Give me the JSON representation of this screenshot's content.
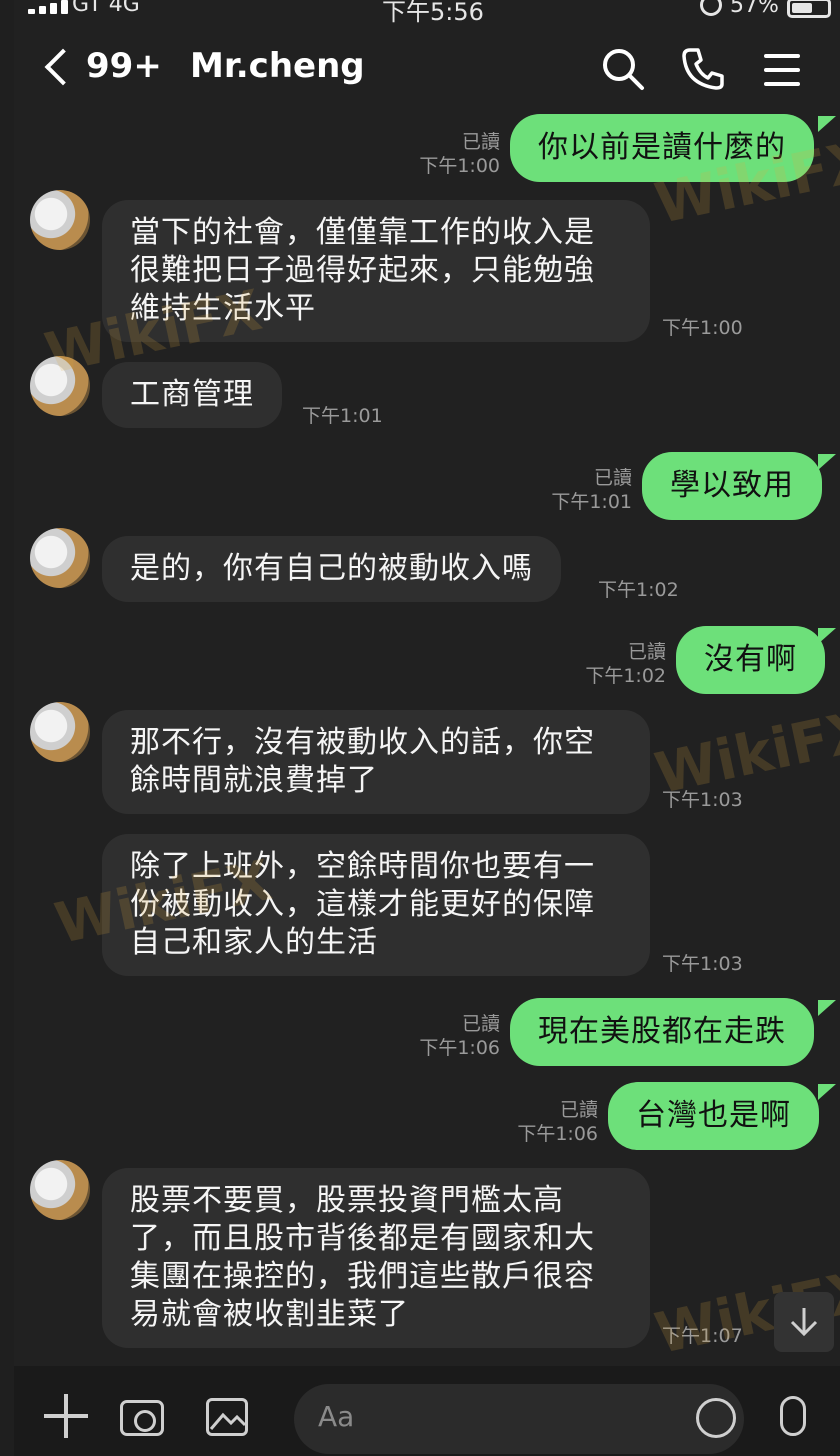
{
  "status_bar": {
    "carrier": "GT  4G",
    "time": "下午5:56",
    "battery": "57%"
  },
  "header": {
    "unread_count": "99+",
    "title": "Mr.cheng"
  },
  "watermark": "WikiFX",
  "messages": [
    {
      "side": "out",
      "text": "你以前是讀什麼的",
      "read": "已讀",
      "time": "下午1:00"
    },
    {
      "side": "in",
      "text": "當下的社會，僅僅靠工作的收入是\n很難把日子過得好起來，只能勉強\n維持生活水平",
      "time": "下午1:00"
    },
    {
      "side": "in",
      "text": "工商管理",
      "time": "下午1:01"
    },
    {
      "side": "out",
      "text": "學以致用",
      "read": "已讀",
      "time": "下午1:01"
    },
    {
      "side": "in",
      "text": "是的，你有自己的被動收入嗎",
      "time": "下午1:02"
    },
    {
      "side": "out",
      "text": "沒有啊",
      "read": "已讀",
      "time": "下午1:02"
    },
    {
      "side": "in",
      "text": "那不行，沒有被動收入的話，你空\n餘時間就浪費掉了",
      "time": "下午1:03"
    },
    {
      "side": "in",
      "text": "除了上班外，空餘時間你也要有一\n份被動收入，這樣才能更好的保障\n自己和家人的生活",
      "time": "下午1:03"
    },
    {
      "side": "out",
      "text": "現在美股都在走跌",
      "read": "已讀",
      "time": "下午1:06"
    },
    {
      "side": "out",
      "text": "台灣也是啊",
      "read": "已讀",
      "time": "下午1:06"
    },
    {
      "side": "in",
      "text": "股票不要買，股票投資門檻太高\n了，而且股市背後都是有國家和大\n集團在操控的，我們這些散戶很容\n易就會被收割韭菜了",
      "time": "下午1:07"
    }
  ],
  "input": {
    "placeholder": "Aa"
  }
}
